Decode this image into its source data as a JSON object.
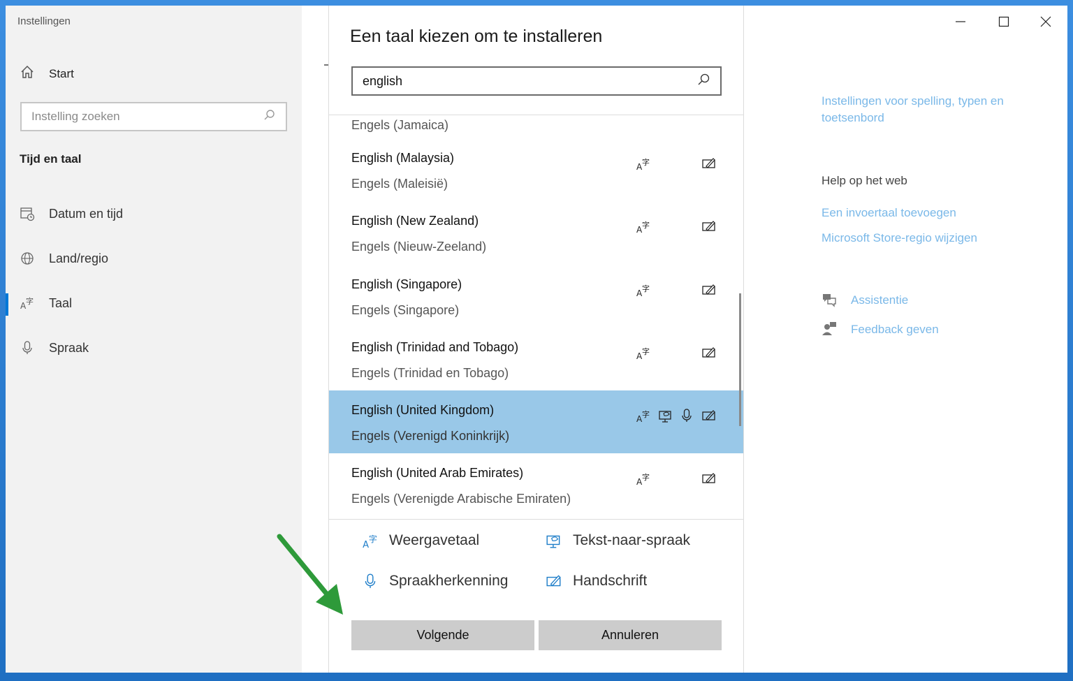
{
  "app": {
    "title": "Instellingen"
  },
  "nav": {
    "home": "Start",
    "search_placeholder": "Instelling zoeken",
    "section": "Tijd en taal",
    "items": [
      {
        "label": "Datum en tijd",
        "icon": "calendar-clock-icon"
      },
      {
        "label": "Land/regio",
        "icon": "globe-icon"
      },
      {
        "label": "Taal",
        "icon": "language-icon"
      },
      {
        "label": "Spraak",
        "icon": "microphone-icon"
      }
    ],
    "active": "Taal"
  },
  "dialog": {
    "title": "Een taal kiezen om te installeren",
    "search_value": "english",
    "partial_item_local": "Engels (Jamaica)",
    "languages": [
      {
        "name": "English (Malaysia)",
        "local": "Engels (Maleisië)",
        "features": [
          "display",
          "handwriting"
        ]
      },
      {
        "name": "English (New Zealand)",
        "local": "Engels (Nieuw-Zeeland)",
        "features": [
          "display",
          "handwriting"
        ]
      },
      {
        "name": "English (Singapore)",
        "local": "Engels (Singapore)",
        "features": [
          "display",
          "handwriting"
        ]
      },
      {
        "name": "English (Trinidad and Tobago)",
        "local": "Engels (Trinidad en Tobago)",
        "features": [
          "display",
          "handwriting"
        ]
      },
      {
        "name": "English (United Kingdom)",
        "local": "Engels (Verenigd Koninkrijk)",
        "features": [
          "display",
          "tts",
          "speech",
          "handwriting"
        ],
        "selected": true
      },
      {
        "name": "English (United Arab Emirates)",
        "local": "Engels (Verenigde Arabische Emiraten)",
        "features": [
          "display",
          "handwriting"
        ]
      }
    ],
    "legend": {
      "display": "Weergavetaal",
      "tts": "Tekst-naar-spraak",
      "speech": "Spraakherkenning",
      "handwriting": "Handschrift"
    },
    "buttons": {
      "next": "Volgende",
      "cancel": "Annuleren"
    }
  },
  "right": {
    "link_spelling": "Instellingen voor spelling, typen en toetsenbord",
    "help_heading": "Help op het web",
    "link_input": "Een invoertaal toevoegen",
    "link_store": "Microsoft Store-regio wijzigen",
    "assist": "Assistentie",
    "feedback": "Feedback geven"
  },
  "colors": {
    "accent": "#0078d7",
    "selected_row": "#99c8e8",
    "link": "#7ab8e8",
    "arrow": "#2e9a3a"
  }
}
